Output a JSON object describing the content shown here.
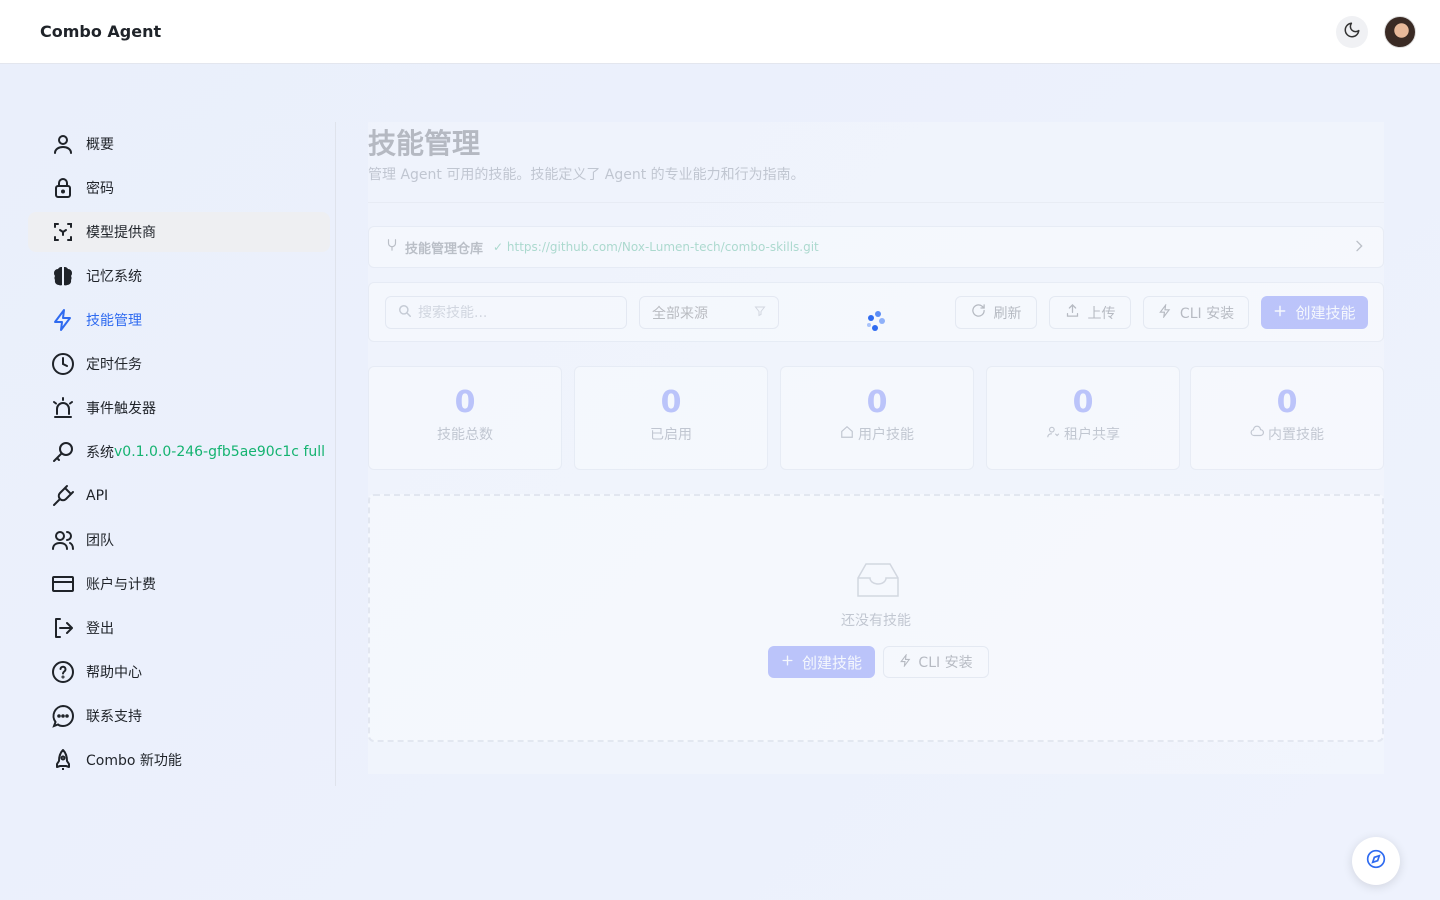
{
  "app": {
    "title": "Combo Agent"
  },
  "sidebar": {
    "items": [
      {
        "label": "概要",
        "icon": "user-icon"
      },
      {
        "label": "密码",
        "icon": "lock-icon"
      },
      {
        "label": "模型提供商",
        "icon": "model-provider-icon"
      },
      {
        "label": "记忆系统",
        "icon": "brain-icon"
      },
      {
        "label": "技能管理",
        "icon": "lightning-icon"
      },
      {
        "label": "定时任务",
        "icon": "clock-icon"
      },
      {
        "label": "事件触发器",
        "icon": "alarm-icon"
      },
      {
        "label": "系统",
        "icon": "key-icon",
        "version": "v0.1.0.0-246-gfb5ae90c1c full"
      },
      {
        "label": "API",
        "icon": "plug-icon"
      },
      {
        "label": "团队",
        "icon": "team-icon"
      },
      {
        "label": "账户与计费",
        "icon": "credit-card-icon"
      },
      {
        "label": "登出",
        "icon": "logout-icon"
      },
      {
        "label": "帮助中心",
        "icon": "help-icon"
      },
      {
        "label": "联系支持",
        "icon": "chat-icon"
      },
      {
        "label": "Combo 新功能",
        "icon": "rocket-icon"
      }
    ],
    "active_index": 4,
    "hover_index": 2
  },
  "main": {
    "title": "技能管理",
    "subtitle": "管理 Agent 可用的技能。技能定义了 Agent 的专业能力和行为指南。",
    "repo": {
      "label": "技能管理仓库",
      "url": "https://github.com/Nox-Lumen-tech/combo-skills.git"
    },
    "toolbar": {
      "search_placeholder": "搜索技能...",
      "source_filter": "全部来源",
      "refresh_label": "刷新",
      "upload_label": "上传",
      "cli_install_label": "CLI 安装",
      "create_label": "创建技能"
    },
    "stats": [
      {
        "value": "0",
        "label": "技能总数",
        "icon": ""
      },
      {
        "value": "0",
        "label": "已启用",
        "icon": ""
      },
      {
        "value": "0",
        "label": "用户技能",
        "icon": "home-icon"
      },
      {
        "value": "0",
        "label": "租户共享",
        "icon": "share-user-icon"
      },
      {
        "value": "0",
        "label": "内置技能",
        "icon": "cloud-icon"
      }
    ],
    "empty": {
      "text": "还没有技能",
      "create_label": "创建技能",
      "cli_label": "CLI 安装"
    },
    "loading": true
  },
  "colors": {
    "accent": "#2f6bf0",
    "primary_button": "#5b6cf5",
    "version_text": "#15b371",
    "repo_url": "#2fa87a"
  }
}
